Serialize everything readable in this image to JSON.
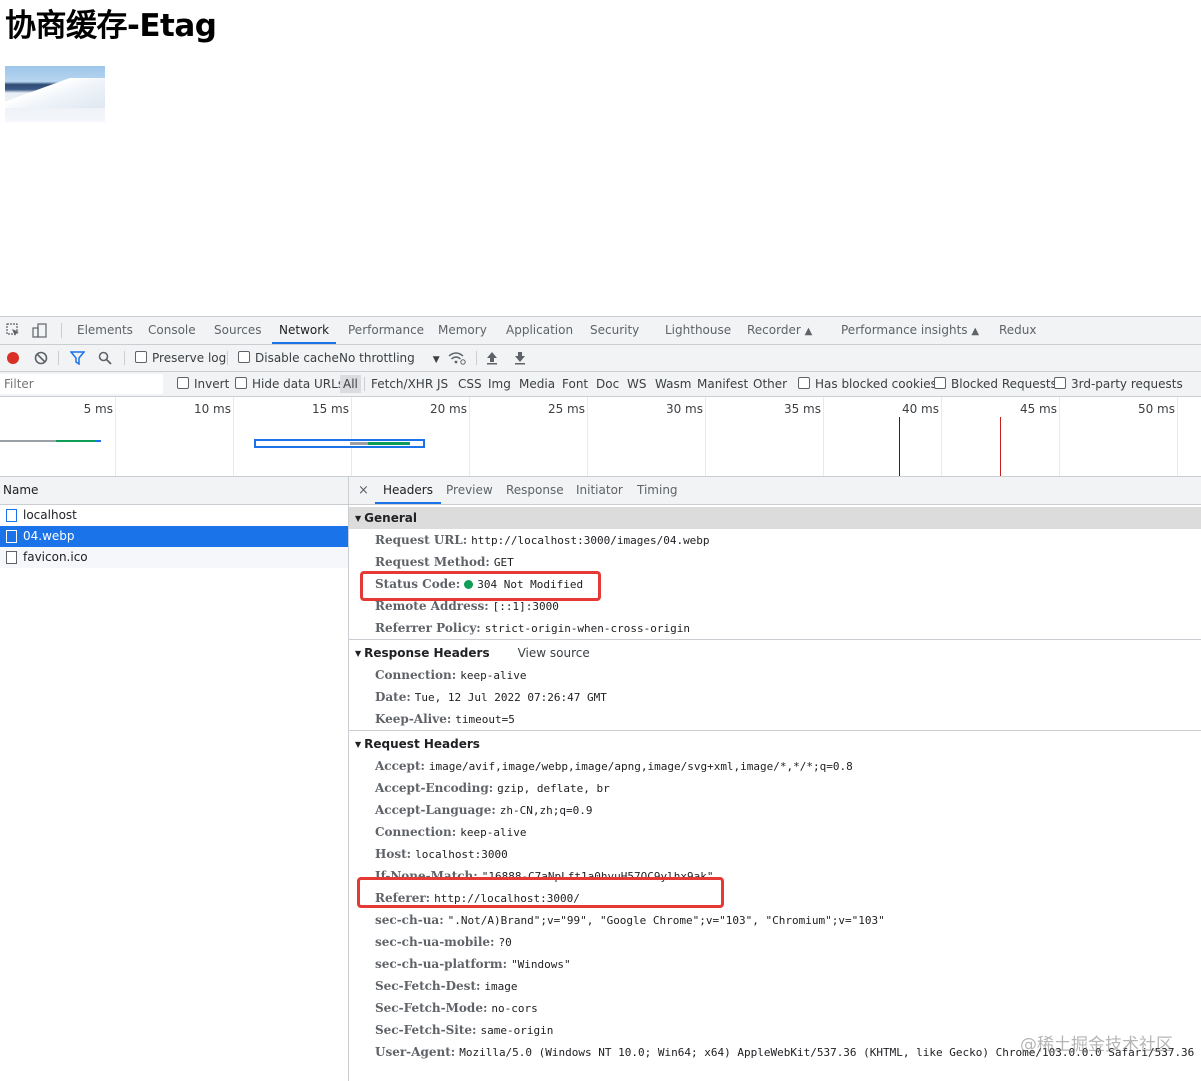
{
  "page": {
    "title": "协商缓存-Etag",
    "image_alt": "snowy mountain landscape"
  },
  "devtools": {
    "tabs": [
      "Elements",
      "Console",
      "Sources",
      "Network",
      "Performance",
      "Memory",
      "Application",
      "Security",
      "Lighthouse",
      "Recorder",
      "Performance insights",
      "Redux"
    ],
    "active_tab": "Network",
    "toolbar": {
      "preserve_log": "Preserve log",
      "disable_cache": "Disable cache",
      "throttling": "No throttling"
    },
    "filter": {
      "placeholder": "Filter",
      "invert": "Invert",
      "hide_data_urls": "Hide data URLs",
      "types": [
        "All",
        "Fetch/XHR",
        "JS",
        "CSS",
        "Img",
        "Media",
        "Font",
        "Doc",
        "WS",
        "Wasm",
        "Manifest",
        "Other"
      ],
      "selected_type": "All",
      "has_blocked_cookies": "Has blocked cookies",
      "blocked_requests": "Blocked Requests",
      "third_party": "3rd-party requests"
    },
    "timeline_ticks": [
      "5 ms",
      "10 ms",
      "15 ms",
      "20 ms",
      "25 ms",
      "30 ms",
      "35 ms",
      "40 ms",
      "45 ms",
      "50 ms"
    ],
    "requests": {
      "header": "Name",
      "items": [
        "localhost",
        "04.webp",
        "favicon.ico"
      ],
      "selected": "04.webp"
    },
    "details": {
      "close": "×",
      "tabs": [
        "Headers",
        "Preview",
        "Response",
        "Initiator",
        "Timing"
      ],
      "active_tab": "Headers",
      "general": {
        "title": "General",
        "rows": [
          {
            "key": "Request URL:",
            "value": "http://localhost:3000/images/04.webp"
          },
          {
            "key": "Request Method:",
            "value": "GET"
          },
          {
            "key": "Status Code:",
            "value": "304 Not Modified"
          },
          {
            "key": "Remote Address:",
            "value": "[::1]:3000"
          },
          {
            "key": "Referrer Policy:",
            "value": "strict-origin-when-cross-origin"
          }
        ]
      },
      "response_headers": {
        "title": "Response Headers",
        "view_source": "View source",
        "rows": [
          {
            "key": "Connection:",
            "value": "keep-alive"
          },
          {
            "key": "Date:",
            "value": "Tue, 12 Jul 2022 07:26:47 GMT"
          },
          {
            "key": "Keep-Alive:",
            "value": "timeout=5"
          }
        ]
      },
      "request_headers": {
        "title": "Request Headers",
        "rows": [
          {
            "key": "Accept:",
            "value": "image/avif,image/webp,image/apng,image/svg+xml,image/*,*/*;q=0.8"
          },
          {
            "key": "Accept-Encoding:",
            "value": "gzip, deflate, br"
          },
          {
            "key": "Accept-Language:",
            "value": "zh-CN,zh;q=0.9"
          },
          {
            "key": "Connection:",
            "value": "keep-alive"
          },
          {
            "key": "Host:",
            "value": "localhost:3000"
          },
          {
            "key": "If-None-Match:",
            "value": "\"16888-C7aNpLft1a0hvuH57OC9ylhx9ak\""
          },
          {
            "key": "Referer:",
            "value": "http://localhost:3000/"
          },
          {
            "key": "sec-ch-ua:",
            "value": "\".Not/A)Brand\";v=\"99\", \"Google Chrome\";v=\"103\", \"Chromium\";v=\"103\""
          },
          {
            "key": "sec-ch-ua-mobile:",
            "value": "?0"
          },
          {
            "key": "sec-ch-ua-platform:",
            "value": "\"Windows\""
          },
          {
            "key": "Sec-Fetch-Dest:",
            "value": "image"
          },
          {
            "key": "Sec-Fetch-Mode:",
            "value": "no-cors"
          },
          {
            "key": "Sec-Fetch-Site:",
            "value": "same-origin"
          },
          {
            "key": "User-Agent:",
            "value": "Mozilla/5.0 (Windows NT 10.0; Win64; x64) AppleWebKit/537.36 (KHTML, like Gecko) Chrome/103.0.0.0 Safari/537.36"
          }
        ]
      }
    }
  },
  "watermark": "@稀土掘金技术社区",
  "colors": {
    "accent": "#1a73e8",
    "highlight_box": "#e53935",
    "status_ok": "#0f9d58",
    "record": "#d93025"
  }
}
